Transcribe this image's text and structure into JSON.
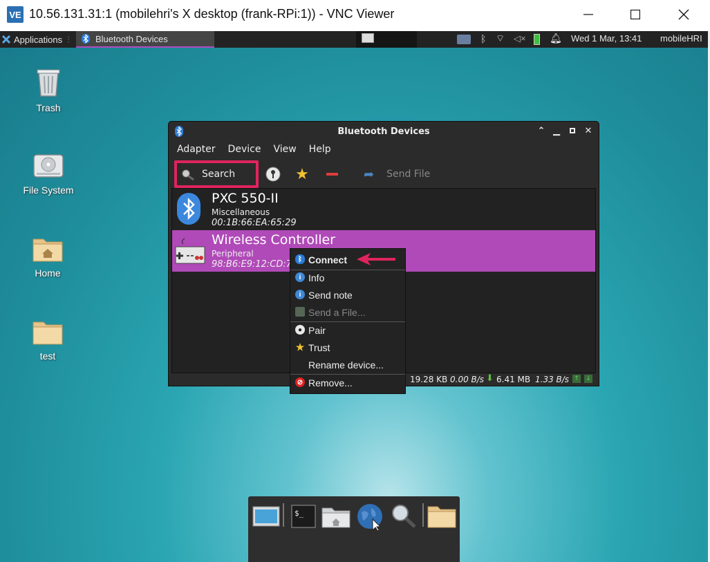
{
  "vnc": {
    "logo": "VE",
    "title": "10.56.131.31:1 (mobilehri's X desktop (frank-RPi:1)) - VNC Viewer",
    "minimize_icon": "minimize-icon",
    "maximize_icon": "maximize-icon",
    "close_icon": "close-icon"
  },
  "panel": {
    "applications": "Applications",
    "task": "Bluetooth Devices",
    "clock": "Wed  1 Mar, 13:41",
    "user": "mobileHRI"
  },
  "desktop_icons": [
    {
      "label": "Trash",
      "icon": "trash-icon"
    },
    {
      "label": "File System",
      "icon": "drive-icon"
    },
    {
      "label": "Home",
      "icon": "home-folder-icon"
    },
    {
      "label": "test",
      "icon": "folder-icon"
    }
  ],
  "bt": {
    "title": "Bluetooth Devices",
    "menu": [
      "Adapter",
      "Device",
      "View",
      "Help"
    ],
    "toolbar": {
      "search": "Search",
      "send_file": "Send File"
    },
    "devices": [
      {
        "name": "PXC 550-II",
        "type": "Miscellaneous",
        "address": "00:1B:66:EA:65:29"
      },
      {
        "name": "Wireless Controller",
        "type": "Peripheral",
        "address": "98:B6:E9:12:CD:7C"
      }
    ],
    "status": {
      "received": "19.28 KB",
      "rx_rate": "0.00 B/s",
      "sent": "6.41 MB",
      "tx_rate": "1.33 B/s"
    }
  },
  "context_menu": {
    "connect": "Connect",
    "info": "Info",
    "send_note": "Send note",
    "send_file": "Send a File...",
    "pair": "Pair",
    "trust": "Trust",
    "rename": "Rename device...",
    "remove": "Remove..."
  },
  "colors": {
    "accent": "#b04ab8",
    "highlight": "#e0245e",
    "bluetooth": "#2b7cd8"
  }
}
